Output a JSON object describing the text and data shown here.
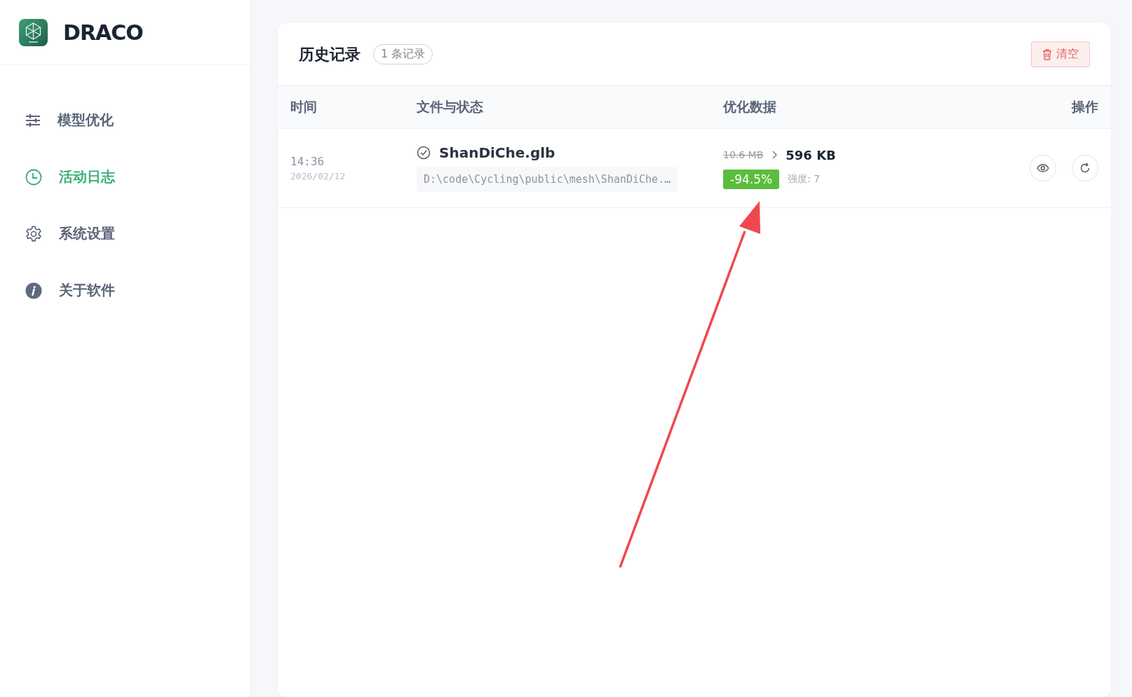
{
  "app": {
    "name": "DRACO"
  },
  "sidebar": {
    "items": [
      {
        "label": "模型优化",
        "kind": "sliders",
        "selected": false
      },
      {
        "label": "活动日志",
        "kind": "clock",
        "selected": true
      },
      {
        "label": "系统设置",
        "kind": "gear",
        "selected": false
      },
      {
        "label": "关于软件",
        "kind": "info",
        "selected": false
      }
    ]
  },
  "history": {
    "title": "历史记录",
    "count": "1 条记录",
    "clear_button": "清空",
    "columns": [
      "时间",
      "文件与状态",
      "优化数据",
      "操作"
    ],
    "rows": [
      {
        "time": "14:36",
        "date": "2026/02/12",
        "done": true,
        "file": "ShanDiChe.glb",
        "path": "D:\\code\\Cycling\\public\\mesh\\ShanDiChe.…",
        "original_size": "10.6 MB",
        "optimized_size": "596 KB",
        "reduction": "-94.5%",
        "strength": "强度: 7"
      }
    ]
  }
}
